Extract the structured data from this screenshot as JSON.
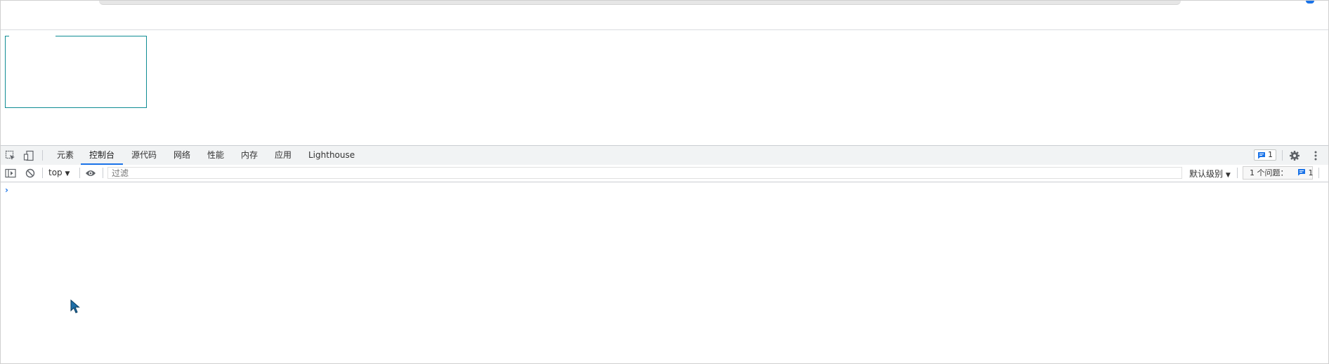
{
  "devtools": {
    "tabs": [
      "元素",
      "控制台",
      "源代码",
      "网络",
      "性能",
      "内存",
      "应用",
      "Lighthouse"
    ],
    "active_tab": "控制台",
    "issue_badge_count": "1"
  },
  "console": {
    "context": "top",
    "filter_placeholder": "过滤",
    "levels": "默认级别",
    "issues_label": "1 个问题：",
    "issues_count": "1",
    "prompt": "›"
  },
  "colors": {
    "accent": "#1a73e8",
    "highlight": "#0f8c94",
    "tabbar_bg": "#f1f3f4"
  }
}
